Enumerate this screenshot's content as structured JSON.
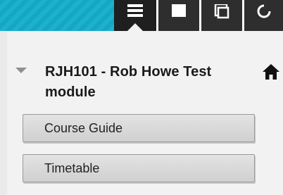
{
  "course": {
    "title": "RJH101 - Rob Howe Test module"
  },
  "menu": {
    "items": [
      {
        "label": "Course Guide"
      },
      {
        "label": "Timetable"
      }
    ]
  },
  "toolbar": {
    "tabs": [
      {
        "icon": "menu-icon",
        "active": true
      },
      {
        "icon": "page-icon",
        "active": false
      },
      {
        "icon": "copy-icon",
        "active": false
      },
      {
        "icon": "refresh-icon",
        "active": false
      }
    ]
  },
  "colors": {
    "topbar_teal": "#1bb2cf",
    "tab_dark": "#2e2e2e",
    "panel_bg": "#f2f2f2",
    "home_icon": "#111111"
  }
}
